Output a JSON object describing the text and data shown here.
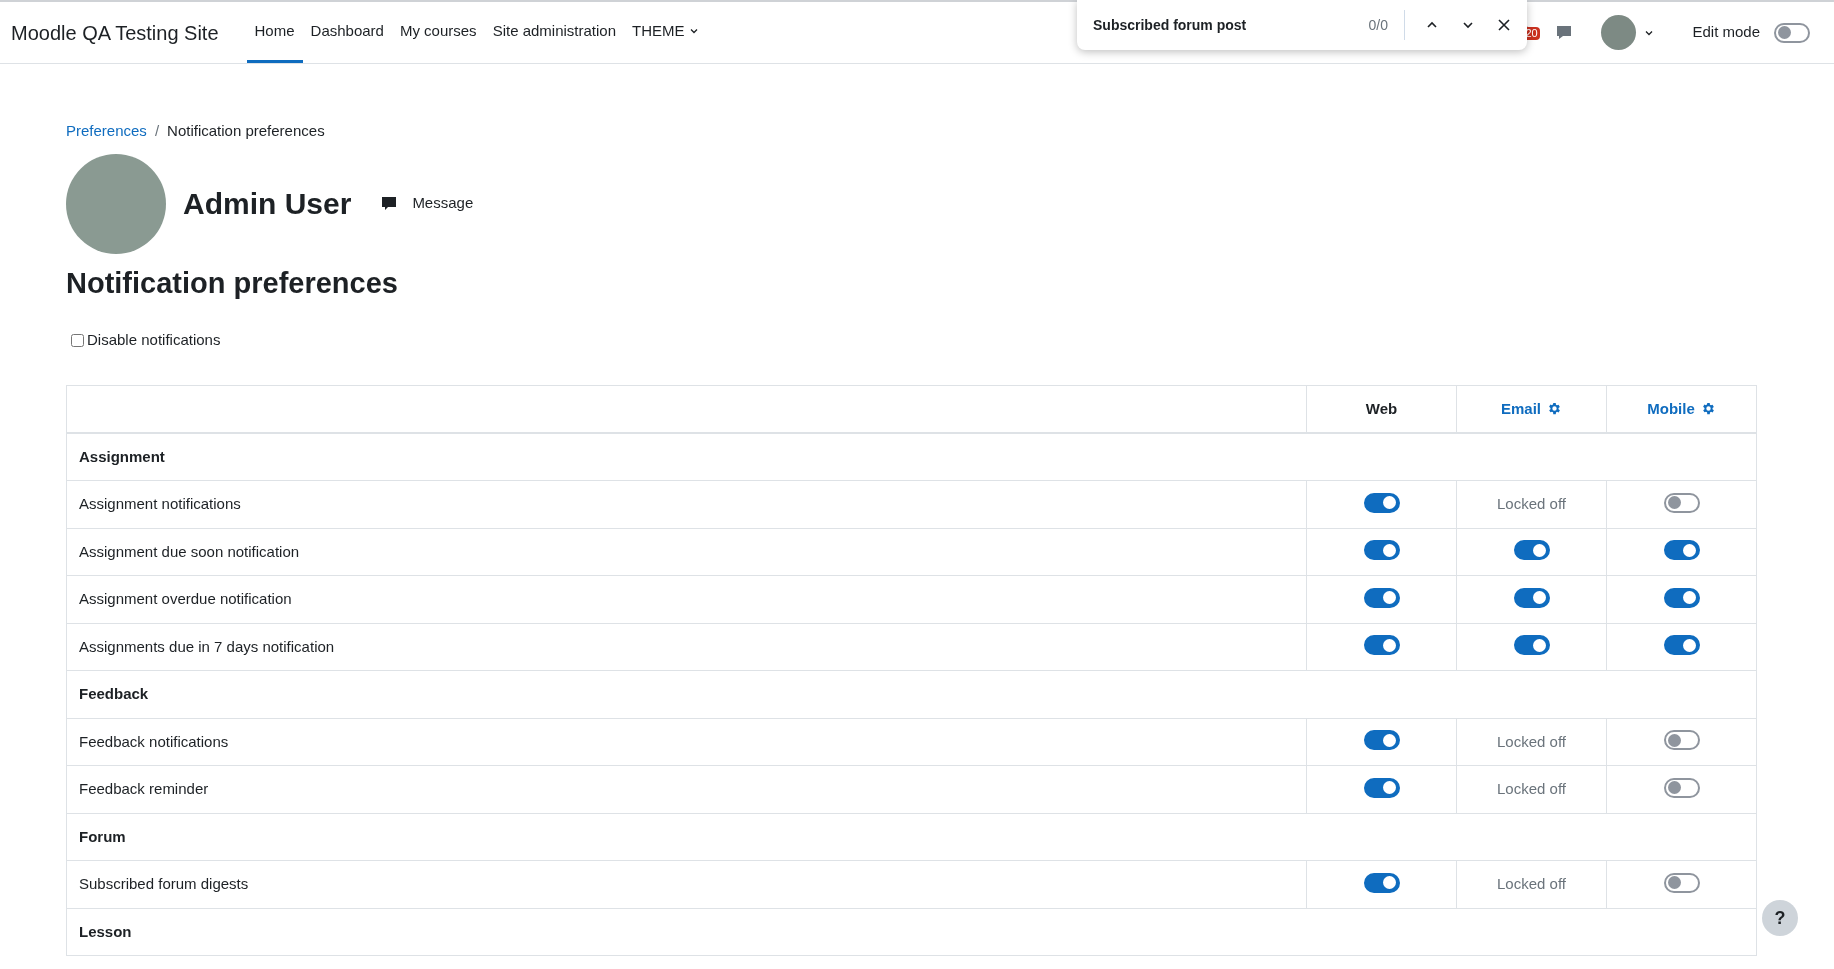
{
  "site_name": "Moodle QA Testing Site",
  "nav": [
    {
      "label": "Home",
      "selected": true
    },
    {
      "label": "Dashboard",
      "selected": false
    },
    {
      "label": "My courses",
      "selected": false
    },
    {
      "label": "Site administration",
      "selected": false
    },
    {
      "label": "THEME",
      "selected": false,
      "dropdown": true
    }
  ],
  "find_bar": {
    "value": "Subscribed forum post",
    "count": "0/0"
  },
  "notification_badge": "20",
  "edit_mode": {
    "label": "Edit mode",
    "on": false
  },
  "breadcrumb_separator": "/",
  "breadcrumb": [
    {
      "label": "Preferences",
      "link": true
    },
    {
      "label": "Notification preferences",
      "link": false
    }
  ],
  "user": {
    "name": "Admin User",
    "message": "Message"
  },
  "heading": "Notification preferences",
  "disable_notifications": {
    "label": "Disable notifications",
    "checked": false
  },
  "table": {
    "columns": [
      {
        "label": "Web",
        "settings": false
      },
      {
        "label": "Email",
        "settings": true
      },
      {
        "label": "Mobile",
        "settings": true
      }
    ],
    "rows": [
      {
        "kind": "group",
        "label": "Assignment"
      },
      {
        "kind": "item",
        "label": "Assignment notifications",
        "cells": [
          {
            "kind": "toggle",
            "on": true
          },
          {
            "kind": "locked",
            "text": "Locked off"
          },
          {
            "kind": "toggle",
            "on": false
          }
        ]
      },
      {
        "kind": "item",
        "label": "Assignment due soon notification",
        "cells": [
          {
            "kind": "toggle",
            "on": true
          },
          {
            "kind": "toggle",
            "on": true
          },
          {
            "kind": "toggle",
            "on": true
          }
        ]
      },
      {
        "kind": "item",
        "label": "Assignment overdue notification",
        "cells": [
          {
            "kind": "toggle",
            "on": true
          },
          {
            "kind": "toggle",
            "on": true
          },
          {
            "kind": "toggle",
            "on": true
          }
        ]
      },
      {
        "kind": "item",
        "label": "Assignments due in 7 days notification",
        "cells": [
          {
            "kind": "toggle",
            "on": true
          },
          {
            "kind": "toggle",
            "on": true
          },
          {
            "kind": "toggle",
            "on": true
          }
        ]
      },
      {
        "kind": "group",
        "label": "Feedback"
      },
      {
        "kind": "item",
        "label": "Feedback notifications",
        "cells": [
          {
            "kind": "toggle",
            "on": true
          },
          {
            "kind": "locked",
            "text": "Locked off"
          },
          {
            "kind": "toggle",
            "on": false
          }
        ]
      },
      {
        "kind": "item",
        "label": "Feedback reminder",
        "cells": [
          {
            "kind": "toggle",
            "on": true
          },
          {
            "kind": "locked",
            "text": "Locked off"
          },
          {
            "kind": "toggle",
            "on": false
          }
        ]
      },
      {
        "kind": "group",
        "label": "Forum"
      },
      {
        "kind": "item",
        "label": "Subscribed forum digests",
        "cells": [
          {
            "kind": "toggle",
            "on": true
          },
          {
            "kind": "locked",
            "text": "Locked off"
          },
          {
            "kind": "toggle",
            "on": false
          }
        ]
      },
      {
        "kind": "group",
        "label": "Lesson"
      }
    ]
  },
  "help_button": "?"
}
